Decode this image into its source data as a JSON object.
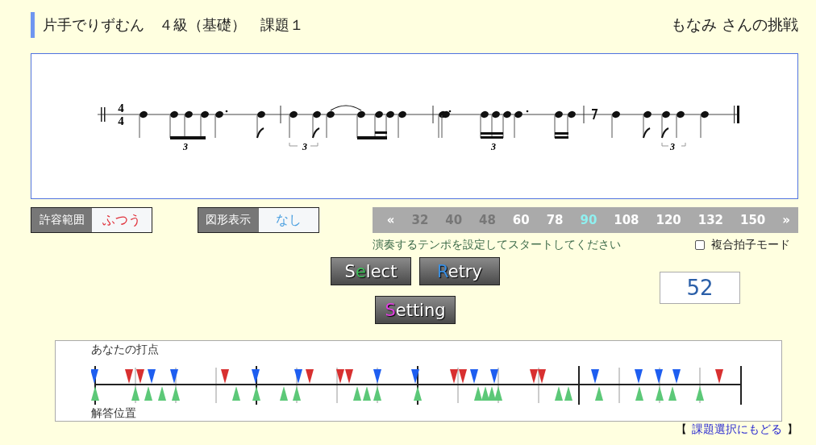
{
  "header": {
    "title": "片手でりずむん　４級（基礎）　課題１",
    "challenger": "もなみ さんの挑戦"
  },
  "score": {
    "time_signature": {
      "numerator": "4",
      "denominator": "4"
    },
    "tuplet_marks": [
      "3",
      "3",
      "3",
      "3"
    ]
  },
  "settings": [
    {
      "label": "許容範囲",
      "value": "ふつう",
      "color": "#e0303a"
    },
    {
      "label": "図形表示",
      "value": "なし",
      "color": "#4a9fe0"
    }
  ],
  "tempo_bar": {
    "prev": "«",
    "next": "»",
    "items": [
      {
        "label": "32",
        "disabled": true,
        "selected": false
      },
      {
        "label": "40",
        "disabled": true,
        "selected": false
      },
      {
        "label": "48",
        "disabled": true,
        "selected": false
      },
      {
        "label": "60",
        "disabled": false,
        "selected": false
      },
      {
        "label": "78",
        "disabled": false,
        "selected": false
      },
      {
        "label": "90",
        "disabled": false,
        "selected": true
      },
      {
        "label": "108",
        "disabled": false,
        "selected": false
      },
      {
        "label": "120",
        "disabled": false,
        "selected": false
      },
      {
        "label": "132",
        "disabled": false,
        "selected": false
      },
      {
        "label": "150",
        "disabled": false,
        "selected": false
      }
    ]
  },
  "message": "演奏するテンポを設定してスタートしてください",
  "compound_meter": {
    "label": "複合拍子モード",
    "checked": false
  },
  "buttons": [
    {
      "before": "S",
      "accent": "e",
      "after": "lect",
      "color": "#3fbf5a"
    },
    {
      "accent": "R",
      "after": "etry",
      "color": "#3a8ee0"
    },
    {
      "accent": "S",
      "after": "etting",
      "color": "#e040e0"
    }
  ],
  "counter": "52",
  "timeline": {
    "top_label": "あなたの打点",
    "bottom_label": "解答位置"
  },
  "back_link": {
    "open": "【",
    "label": "課題選択にもどる",
    "close": "】"
  }
}
